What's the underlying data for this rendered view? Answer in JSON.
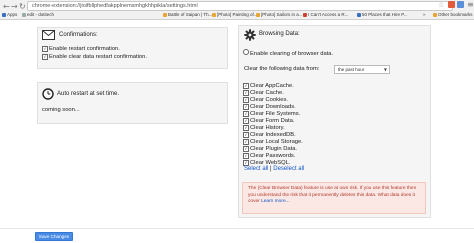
{
  "browser": {
    "url": "chrome-extension://jioifbllphedfakpplnemsmhgkhhpikla/settings.html",
    "bookmarks": [
      {
        "label": "Apps"
      },
      {
        "label": "edit - dotitech"
      },
      {
        "label": "Battle of Saipan | Th..."
      },
      {
        "label": "[Photo] Painting of..."
      },
      {
        "label": "[Photo] Sailors in a..."
      },
      {
        "label": "I Can't Access a R..."
      },
      {
        "label": "50 Places that Hire P..."
      },
      {
        "label": "»"
      },
      {
        "label": "Other bookmarks"
      }
    ]
  },
  "confirmations": {
    "title": "Confirmations:",
    "items": [
      {
        "label": "Enable restart confirmation.",
        "checked": true
      },
      {
        "label": "Enable clear data restart confirmation.",
        "checked": true
      }
    ]
  },
  "auto_restart": {
    "title": "Auto restart at set time.",
    "status": "coming soon..."
  },
  "browsing_data": {
    "title": "Browsing Data:",
    "enable_clearing_label": "Enable clearing of browser data.",
    "clear_from_label": "Clear the following data from:",
    "clear_from_value": "the past hour",
    "items": [
      {
        "label": "Clear AppCache.",
        "checked": true
      },
      {
        "label": "Clear Cache.",
        "checked": true
      },
      {
        "label": "Clear Cookies.",
        "checked": true
      },
      {
        "label": "Clear Downloads.",
        "checked": true
      },
      {
        "label": "Clear File Systems.",
        "checked": true
      },
      {
        "label": "Clear Form Data.",
        "checked": true
      },
      {
        "label": "Clear History.",
        "checked": true
      },
      {
        "label": "Clear IndexedDB.",
        "checked": true
      },
      {
        "label": "Clear Local Storage.",
        "checked": true
      },
      {
        "label": "Clear Plugin Data.",
        "checked": true
      },
      {
        "label": "Clear Passwords.",
        "checked": true
      },
      {
        "label": "Clear WebSQL.",
        "checked": true
      }
    ],
    "select_all": "Select all",
    "separator": "|",
    "deselect_all": "Deselect all",
    "warning_text": "The (Clear Browser Data) feature is use at own risk. If you use this feature then you understand the risk that it permanently deletes this data. What data does it cover",
    "learn_more": "Learn more..."
  },
  "save_button": "Save Changes"
}
